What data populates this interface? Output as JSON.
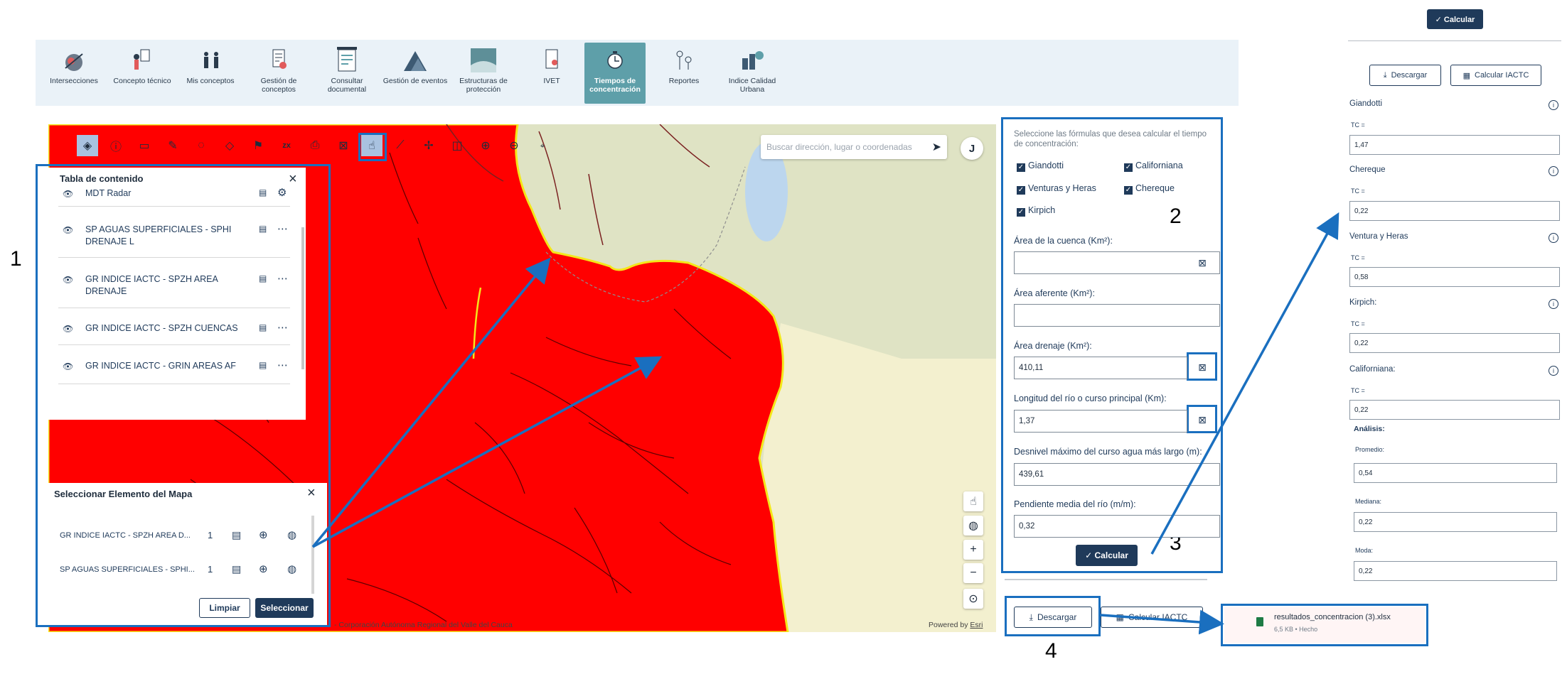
{
  "top_button": {
    "label": "✓ Calcular"
  },
  "nav": {
    "items": [
      {
        "label": "Intersecciones",
        "icon": "intersections-icon"
      },
      {
        "label": "Concepto técnico",
        "icon": "technical-concept-icon"
      },
      {
        "label": "Mis conceptos",
        "icon": "my-concepts-icon"
      },
      {
        "label": "Gestión de conceptos",
        "icon": "concept-management-icon"
      },
      {
        "label": "Consultar documental",
        "icon": "document-search-icon"
      },
      {
        "label": "Gestión de eventos",
        "icon": "events-icon"
      },
      {
        "label": "Estructuras de protección",
        "icon": "protection-structures-icon"
      },
      {
        "label": "IVET",
        "icon": "ivet-icon"
      },
      {
        "label": "Tiempos de concentración",
        "icon": "concentration-time-icon",
        "active": true
      },
      {
        "label": "Reportes",
        "icon": "reports-icon"
      },
      {
        "label": "Indice Calidad Urbana",
        "icon": "urban-quality-icon"
      }
    ]
  },
  "map": {
    "search_placeholder": "Buscar dirección, lugar o coordenadas",
    "user_initial": "J",
    "attribution": "- Corporación Autónoma Regional del Valle del Cauca",
    "powered_by": "Powered by",
    "esri": "Esri",
    "colors": {
      "basin_red": "#ff0000",
      "land": "#dfe3c4",
      "water": "#bcd6ee",
      "border_yellow": "#f4e71a"
    }
  },
  "layers_panel": {
    "title": "Tabla de contenido",
    "layers": [
      {
        "name": "MDT Radar"
      },
      {
        "name": "SP AGUAS SUPERFICIALES - SPHI DRENAJE L"
      },
      {
        "name": "GR INDICE IACTC - SPZH AREA DRENAJE"
      },
      {
        "name": "GR INDICE IACTC - SPZH CUENCAS"
      },
      {
        "name": "GR INDICE IACTC - GRIN AREAS AF"
      }
    ]
  },
  "select_panel": {
    "title": "Seleccionar Elemento del Mapa",
    "rows": [
      {
        "name": "GR INDICE IACTC - SPZH AREA D...",
        "count": "1"
      },
      {
        "name": "SP AGUAS SUPERFICIALES - SPHI...",
        "count": "1"
      }
    ],
    "clear_label": "Limpiar",
    "select_label": "Seleccionar"
  },
  "formula_panel": {
    "intro": "Seleccione las fórmulas que desea calcular el tiempo de concentración:",
    "formulas": [
      "Giandotti",
      "Californiana",
      "Venturas y Heras",
      "Chereque",
      "Kirpich"
    ],
    "fields": [
      {
        "label": "Área de la cuenca (Km²):",
        "value": ""
      },
      {
        "label": "Área aferente (Km²):",
        "value": ""
      },
      {
        "label": "Área drenaje (Km²):",
        "value": "410,11"
      },
      {
        "label": "Longitud del río o curso principal (Km):",
        "value": "1,37"
      },
      {
        "label": "Desnivel máximo del curso agua más largo (m):",
        "value": "439,61"
      },
      {
        "label": "Pendiente media del río (m/m):",
        "value": "0,32"
      }
    ],
    "calc_label": "✓ Calcular",
    "download_label": "Descargar",
    "iactc_label": "Calcular IACTC"
  },
  "download_toast": {
    "filename": "resultados_concentracion (3).xlsx",
    "meta": "6,5 KB • Hecho"
  },
  "results": {
    "download_label": "Descargar",
    "iactc_label": "Calcular IACTC",
    "tc_label": "TC =",
    "items": [
      {
        "name": "Giandotti",
        "value": "1,47"
      },
      {
        "name": "Chereque",
        "value": "0,22"
      },
      {
        "name": "Ventura y Heras",
        "value": "0,58"
      },
      {
        "name": "Kirpich:",
        "value": "0,22"
      },
      {
        "name": "Californiana:",
        "value": "0,22"
      }
    ],
    "analysis_title": "Análisis:",
    "analysis": [
      {
        "name": "Promedio:",
        "value": "0,54"
      },
      {
        "name": "Mediana:",
        "value": "0,22"
      },
      {
        "name": "Moda:",
        "value": "0,22"
      }
    ]
  },
  "annotations": {
    "n1": "1",
    "n2": "2",
    "n3": "3",
    "n4": "4",
    "color": "#1a6fbf"
  }
}
